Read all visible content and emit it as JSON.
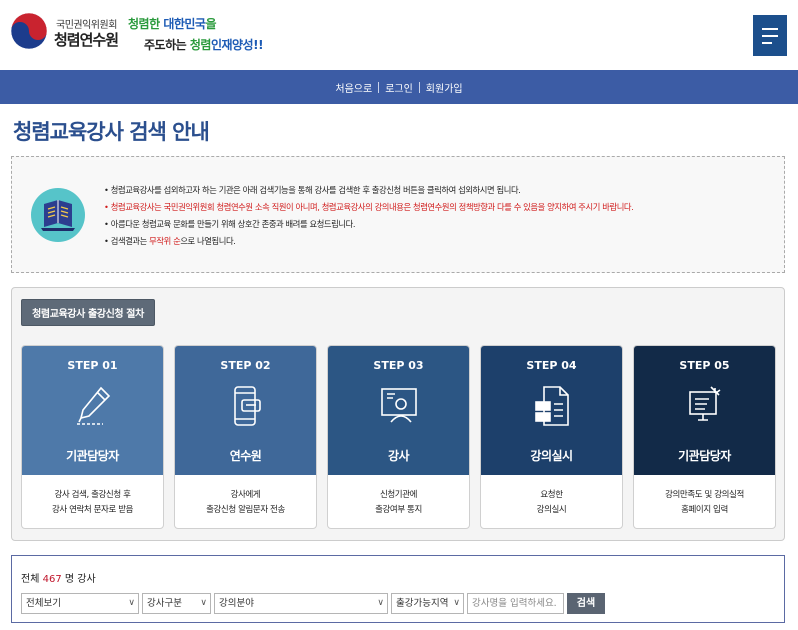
{
  "header": {
    "org_sub": "국민권익위원회",
    "org_name": "청렴연수원",
    "slogan_line1_a": "청렴한 ",
    "slogan_line1_b": "대한민국",
    "slogan_line1_c": "을",
    "slogan_line2_a": "주도하는 ",
    "slogan_line2_b": "청렴",
    "slogan_line2_c": "인재양성!!",
    "menu_icon": "hamburger-icon"
  },
  "topnav": [
    "처음으로",
    "로그인",
    "회원가입"
  ],
  "page_title": "청렴교육강사 검색 안내",
  "notice": {
    "line1": "청렴교육강사를 섭외하고자 하는 기관은 아래 검색기능을 통해 강사를 검색한 후 출강신청 버튼을 클릭하여 섭외하시면 됩니다.",
    "line2": "청렴교육강사는 국민권익위원회 청렴연수원 소속 직원이 아니며, 청렴교육강사의 강의내용은 청렴연수원의 정책방향과 다를 수 있음을 양지하여 주시기 바랍니다.",
    "line3": "아름다운 청렴교육 문화를 만들기 위해 상호간 존중과 배려를 요청드립니다.",
    "line4_a": "검색결과는 ",
    "line4_b": "무작위 순",
    "line4_c": "으로 나열됩니다."
  },
  "procedure": {
    "tag": "청렴교육강사 출강신청 절차",
    "steps": [
      {
        "num": "STEP 01",
        "title": "기관담당자",
        "desc1": "강사 검색, 출강신청 후",
        "desc2": "강사 연락처 문자로 받음",
        "icon": "pen-icon",
        "color": "#4e79a9"
      },
      {
        "num": "STEP 02",
        "title": "연수원",
        "desc1": "강사에게",
        "desc2": "출강신청 알림문자 전송",
        "icon": "mobile-message-icon",
        "color": "#3f6899"
      },
      {
        "num": "STEP 03",
        "title": "강사",
        "desc1": "신청기관에",
        "desc2": "출강여부 통지",
        "icon": "instructor-icon",
        "color": "#2c5684"
      },
      {
        "num": "STEP 04",
        "title": "강의실시",
        "desc1": "요청한",
        "desc2": "강의실시",
        "icon": "document-icon",
        "color": "#1d406b"
      },
      {
        "num": "STEP 05",
        "title": "기관담당자",
        "desc1": "강의만족도 및 강의실적",
        "desc2": "홈페이지 입력",
        "icon": "computer-icon",
        "color": "#122a48"
      }
    ]
  },
  "search": {
    "count_prefix": "전체 ",
    "count_value": "467",
    "count_suffix": " 명 강사",
    "filter1": "전체보기",
    "filter2": "강사구분",
    "filter3": "강의분야",
    "filter4": "출강가능지역",
    "keyword_placeholder": "강사명을 입력하세요.",
    "button": "검색"
  }
}
